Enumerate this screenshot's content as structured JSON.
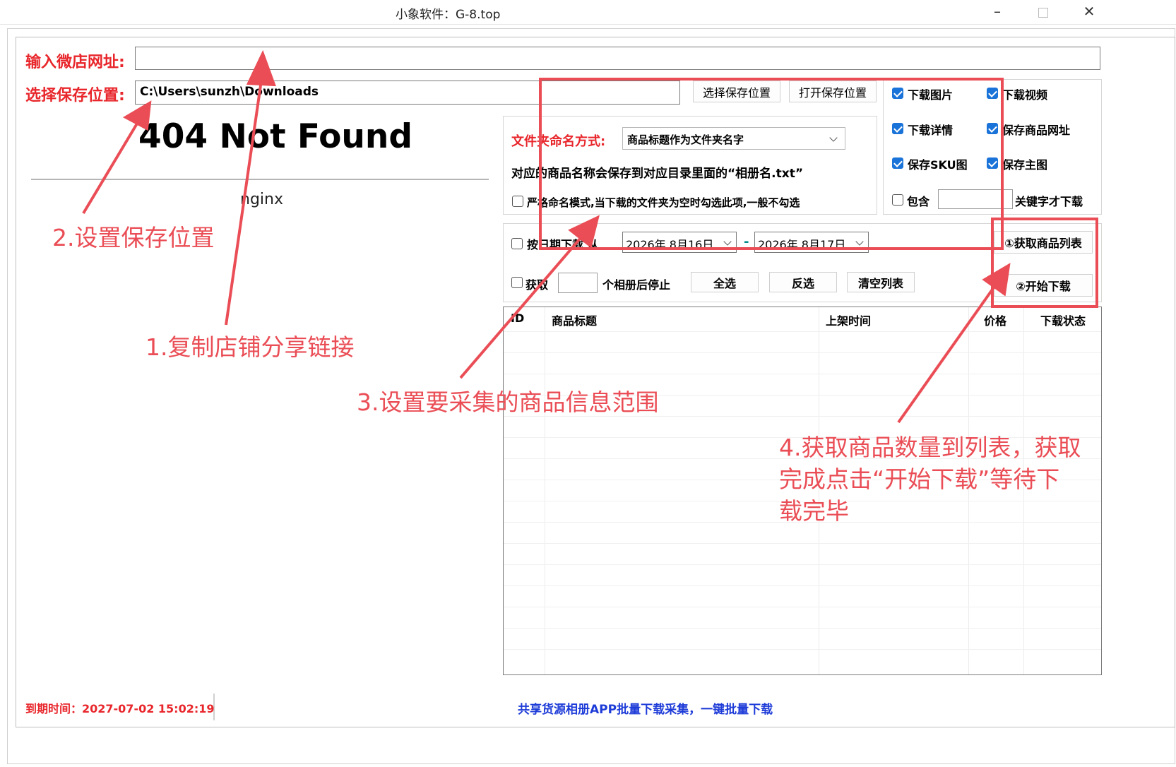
{
  "window": {
    "title": "小象软件：G-8.top"
  },
  "url_row": {
    "label": "输入微店网址:",
    "value": ""
  },
  "save_row": {
    "label": "选择保存位置:",
    "path": "C:\\Users\\sunzh\\Downloads",
    "choose_button": "选择保存位置",
    "open_button": "打开保存位置"
  },
  "web_page": {
    "title": "404 Not Found",
    "server": "nginx"
  },
  "naming": {
    "label": "文件夹命名方式:",
    "selected": "商品标题作为文件夹名字",
    "note": "对应的商品名称会保存到对应目录里面的“相册名.txt”",
    "strict_mode_label": "严格命名模式,当下载的文件夹为空时勾选此项,一般不勾选",
    "strict_mode_checked": false
  },
  "options": [
    {
      "label": "下载图片",
      "checked": true
    },
    {
      "label": "下载视频",
      "checked": true
    },
    {
      "label": "下载详情",
      "checked": true
    },
    {
      "label": "保存商品网址",
      "checked": true
    },
    {
      "label": "保存SKU图",
      "checked": true
    },
    {
      "label": "保存主图",
      "checked": true
    }
  ],
  "keyword_filter": {
    "prefix": "包含",
    "value": "",
    "suffix": "关键字才下载",
    "checked": false
  },
  "date_filter": {
    "label": "按日期下载 从",
    "from": "2026年  8月16日",
    "separator": "-",
    "to": "2026年  8月17日",
    "checked": false
  },
  "stop_after": {
    "prefix": "获取",
    "value": "",
    "suffix": "个相册后停止",
    "checked": false
  },
  "buttons": {
    "select_all": "全选",
    "invert": "反选",
    "clear_list": "清空列表",
    "get_list": "①获取商品列表",
    "start_download": "②开始下载"
  },
  "table": {
    "columns": [
      "ID",
      "商品标题",
      "上架时间",
      "价格",
      "下载状态"
    ]
  },
  "status_bar": {
    "expiry": "到期时间：2027-07-02 15:02:19",
    "promo": "共享货源相册APP批量下载采集，一键批量下载"
  },
  "annotations": {
    "step1": "1.复制店铺分享链接",
    "step2": "2.设置保存位置",
    "step3": "3.设置要采集的商品信息范围",
    "step4_line1": "4.获取商品数量到列表，获取",
    "step4_line2": "完成点击“开始下载”等待下",
    "step4_line3": "载完毕"
  },
  "colors": {
    "label_red": "#e8262b",
    "annotation_red": "#ea4d55",
    "checkbox_blue": "#1a73d9",
    "promo_blue": "#1e3cd8"
  }
}
